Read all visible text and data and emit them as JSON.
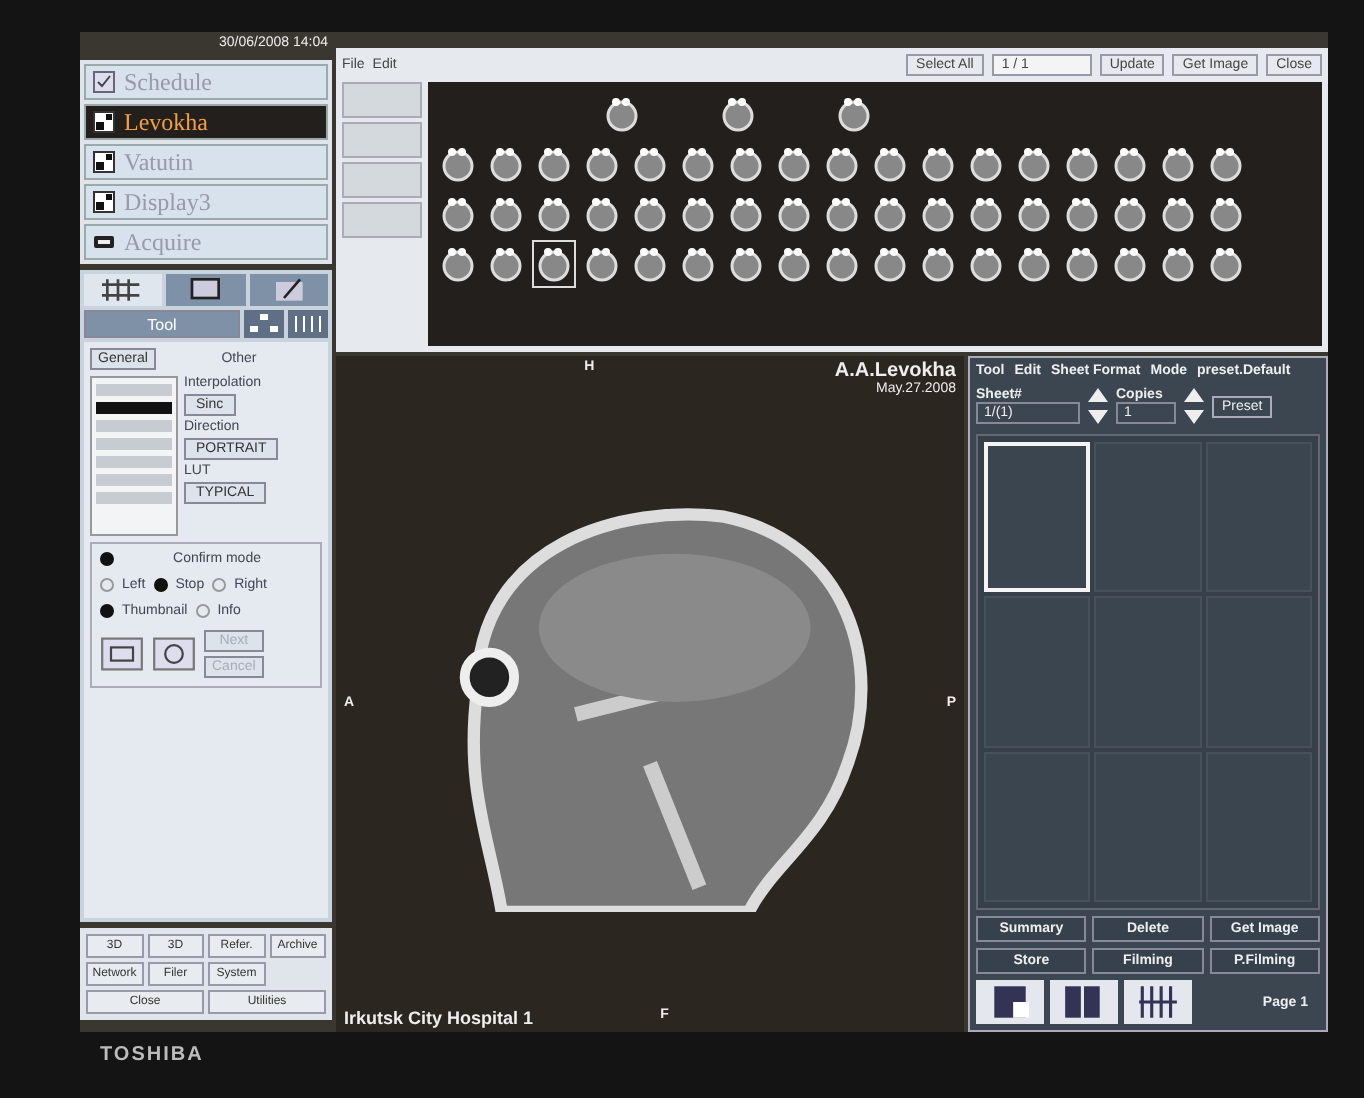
{
  "left_panel": {
    "date": "30/06/2008 14:04",
    "patients": [
      {
        "label": "Schedule",
        "kind": "schedule",
        "selected": false
      },
      {
        "label": "Levokha",
        "kind": "patient",
        "selected": true
      },
      {
        "label": "Vatutin",
        "kind": "patient",
        "selected": false
      },
      {
        "label": "Display3",
        "kind": "patient",
        "selected": false
      },
      {
        "label": "Acquire",
        "kind": "acquire",
        "selected": false
      }
    ],
    "sub_tabs": [
      {
        "label": "Tool",
        "selected": true
      }
    ],
    "settings": {
      "general": "General",
      "other": "Other",
      "interpolation_label": "Interpolation",
      "interpolation": "Sinc",
      "direction_label": "Direction",
      "direction": "PORTRAIT",
      "lut_label": "LUT",
      "lut": "TYPICAL"
    },
    "confirm_mode": {
      "label": "Confirm mode",
      "checked": true
    },
    "radios": [
      {
        "label": "Left",
        "selected": false
      },
      {
        "label": "Stop",
        "selected": true
      },
      {
        "label": "Right",
        "selected": false
      }
    ],
    "checks": [
      {
        "label": "Thumbnail",
        "checked": true
      },
      {
        "label": "Info",
        "checked": false
      }
    ],
    "next": {
      "label": "Next",
      "disabled": true
    },
    "cancel": {
      "label": "Cancel",
      "disabled": true
    },
    "utility_buttons": [
      "3D",
      "3D",
      "Refer.",
      "Archive",
      "Network",
      "Filer",
      "System",
      "Close",
      "Utilities"
    ]
  },
  "gallery": {
    "menu": [
      "File",
      "Edit"
    ],
    "select_all": "Select All",
    "page_field": "1 / 1",
    "buttons": [
      "Update",
      "Get Image",
      "Close"
    ],
    "rows": [
      {
        "thumbnails": [
          {
            "selected": false
          },
          {
            "selected": false
          },
          {
            "selected": false
          }
        ]
      },
      {
        "thumbnails": [
          {
            "selected": false
          },
          {
            "selected": false
          },
          {
            "selected": false
          },
          {
            "selected": false
          },
          {
            "selected": false
          },
          {
            "selected": false
          },
          {
            "selected": false
          },
          {
            "selected": false
          },
          {
            "selected": false
          },
          {
            "selected": false
          },
          {
            "selected": false
          },
          {
            "selected": false
          },
          {
            "selected": false
          },
          {
            "selected": false
          },
          {
            "selected": false
          },
          {
            "selected": false
          },
          {
            "selected": false
          }
        ]
      },
      {
        "thumbnails": [
          {
            "selected": false
          },
          {
            "selected": false
          },
          {
            "selected": false
          },
          {
            "selected": false
          },
          {
            "selected": false
          },
          {
            "selected": false
          },
          {
            "selected": false
          },
          {
            "selected": false
          },
          {
            "selected": false
          },
          {
            "selected": false
          },
          {
            "selected": false
          },
          {
            "selected": false
          },
          {
            "selected": false
          },
          {
            "selected": false
          },
          {
            "selected": false
          },
          {
            "selected": false
          },
          {
            "selected": false
          }
        ]
      },
      {
        "thumbnails": [
          {
            "selected": false
          },
          {
            "selected": false
          },
          {
            "selected": true
          },
          {
            "selected": false
          },
          {
            "selected": false
          },
          {
            "selected": false
          },
          {
            "selected": false
          },
          {
            "selected": false
          },
          {
            "selected": false
          },
          {
            "selected": false
          },
          {
            "selected": false
          },
          {
            "selected": false
          },
          {
            "selected": false
          },
          {
            "selected": false
          },
          {
            "selected": false
          },
          {
            "selected": false
          },
          {
            "selected": false
          }
        ]
      }
    ]
  },
  "viewer": {
    "top_marker": "H",
    "left_marker": "A",
    "right_marker": "P",
    "bottom_marker": "F",
    "patient_name": "A.A.Levokha",
    "date": "May.27.2008",
    "hospital": "Irkutsk City Hospital 1"
  },
  "print_panel": {
    "menu": [
      "Tool",
      "Edit",
      "Sheet Format",
      "Mode",
      "preset.Default"
    ],
    "sheet_label": "Sheet#",
    "sheet_value": "1/(1)",
    "copies_label": "Copies",
    "copies_value": "1",
    "preset": "Preset",
    "film_cells": [
      {
        "selected": true
      },
      {
        "selected": false
      },
      {
        "selected": false
      },
      {
        "selected": false
      },
      {
        "selected": false
      },
      {
        "selected": false
      },
      {
        "selected": false
      },
      {
        "selected": false
      },
      {
        "selected": false
      }
    ],
    "buttons": [
      "Summary",
      "Delete",
      "Get Image",
      "Store",
      "Filming",
      "P.Filming"
    ],
    "page": "Page 1"
  },
  "brand": "TOSHIBA"
}
